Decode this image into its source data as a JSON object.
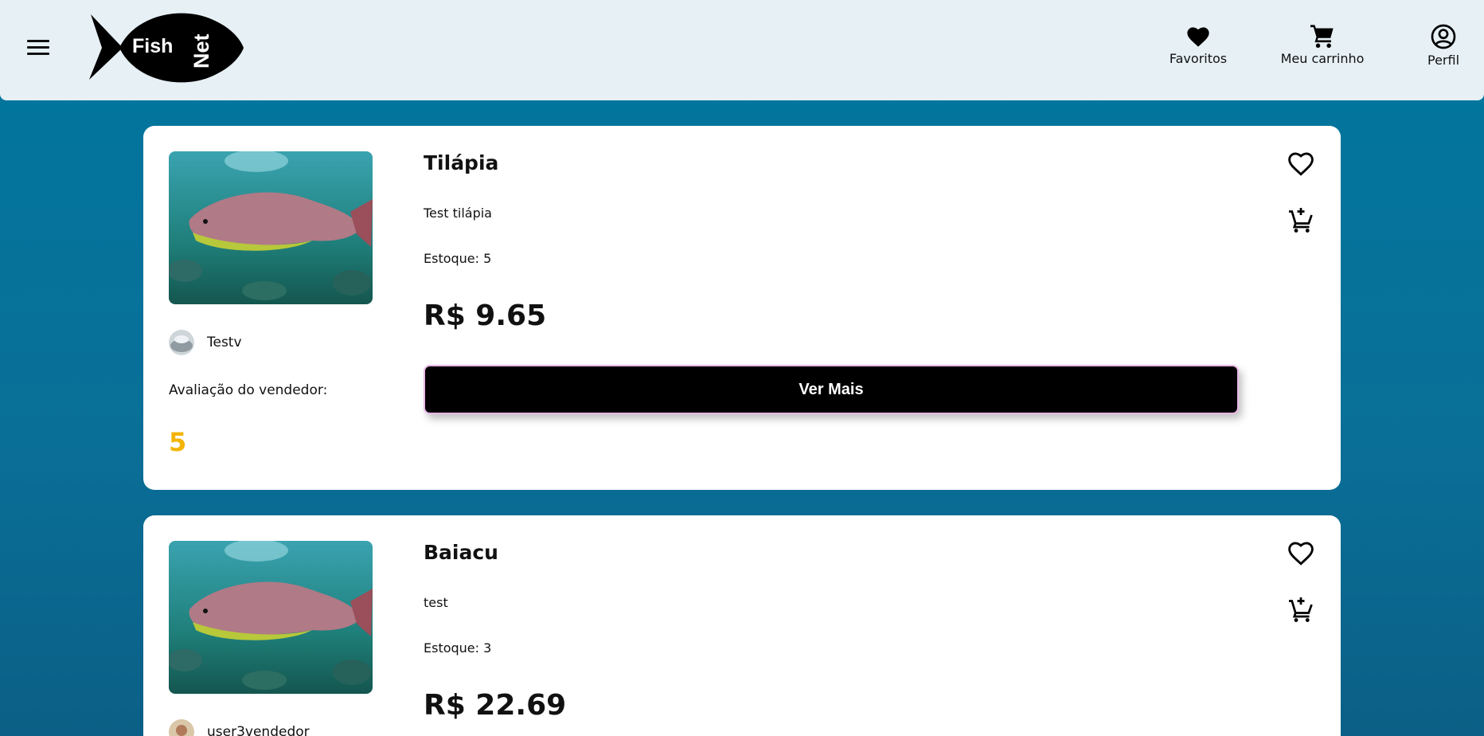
{
  "header": {
    "logo_text_1": "Fish",
    "logo_text_2": "Net",
    "nav": {
      "favorites_label": "Favoritos",
      "cart_label": "Meu carrinho",
      "profile_label": "Perfil"
    }
  },
  "products": [
    {
      "name": "Tilápia",
      "description": "Test tilápia",
      "stock": "Estoque: 5",
      "price": "R$ 9.65",
      "seller": "Testv",
      "rating_label": "Avaliação do vendedor:",
      "rating": "5",
      "button_label": "Ver Mais"
    },
    {
      "name": "Baiacu",
      "description": "test",
      "stock": "Estoque: 3",
      "price": "R$ 22.69",
      "seller": "user3vendedor"
    }
  ],
  "colors": {
    "page_background": "#00779f",
    "header_background": "#e6f0f5",
    "button_background": "#000000",
    "button_border": "#e9b8e8",
    "rating": "#f4b400"
  }
}
